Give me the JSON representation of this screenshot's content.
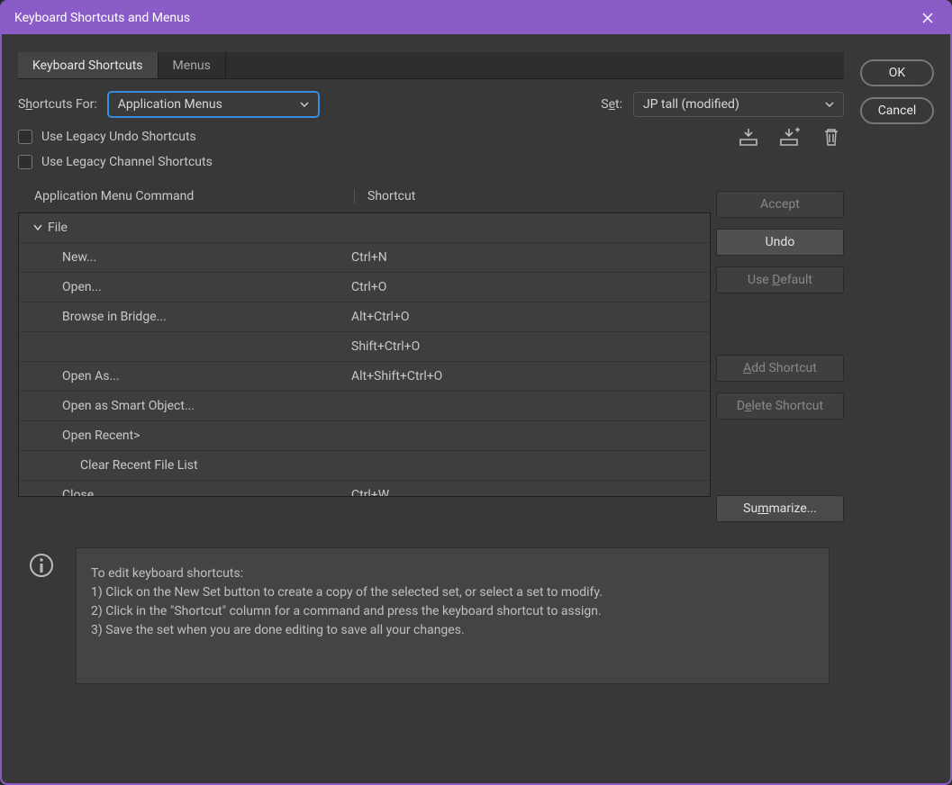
{
  "window": {
    "title": "Keyboard Shortcuts and Menus"
  },
  "side": {
    "ok": "OK",
    "cancel": "Cancel"
  },
  "tabs": {
    "shortcuts": "Keyboard Shortcuts",
    "menus": "Menus"
  },
  "shortcuts_for": {
    "label_pre": "S",
    "label_ul": "h",
    "label_post": "ortcuts For:",
    "value": "Application Menus"
  },
  "set": {
    "label_pre": "S",
    "label_ul": "e",
    "label_post": "t:",
    "value": "JP tall (modified)"
  },
  "checks": {
    "legacy_undo": "Use Legacy Undo Shortcuts",
    "legacy_channel": "Use Legacy Channel Shortcuts"
  },
  "headers": {
    "command": "Application Menu Command",
    "shortcut": "Shortcut"
  },
  "table": [
    {
      "type": "group",
      "label": "File"
    },
    {
      "type": "item",
      "indent": 1,
      "label": "New...",
      "shortcut": "Ctrl+N"
    },
    {
      "type": "item",
      "indent": 1,
      "label": "Open...",
      "shortcut": "Ctrl+O"
    },
    {
      "type": "item",
      "indent": 1,
      "label": "Browse in Bridge...",
      "shortcut": "Alt+Ctrl+O"
    },
    {
      "type": "item",
      "indent": 1,
      "label": "",
      "shortcut": "Shift+Ctrl+O"
    },
    {
      "type": "item",
      "indent": 1,
      "label": "Open As...",
      "shortcut": "Alt+Shift+Ctrl+O"
    },
    {
      "type": "item",
      "indent": 1,
      "label": "Open as Smart Object...",
      "shortcut": ""
    },
    {
      "type": "item",
      "indent": 1,
      "label": "Open Recent>",
      "shortcut": ""
    },
    {
      "type": "item",
      "indent": 2,
      "label": "Clear Recent File List",
      "shortcut": ""
    },
    {
      "type": "item",
      "indent": 1,
      "label": "Close",
      "shortcut": "Ctrl+W"
    }
  ],
  "actions": {
    "accept": "Accept",
    "undo": "Undo",
    "use_default": "Use Default",
    "add": "Add Shortcut",
    "delete": "Delete Shortcut",
    "summarize": "Summarize..."
  },
  "help": {
    "title": "To edit keyboard shortcuts:",
    "l1": "1) Click on the New Set button to create a copy of the selected set, or select a set to modify.",
    "l2": "2) Click in the \"Shortcut\" column for a command and press the keyboard shortcut to assign.",
    "l3": "3) Save the set when you are done editing to save all your changes."
  }
}
